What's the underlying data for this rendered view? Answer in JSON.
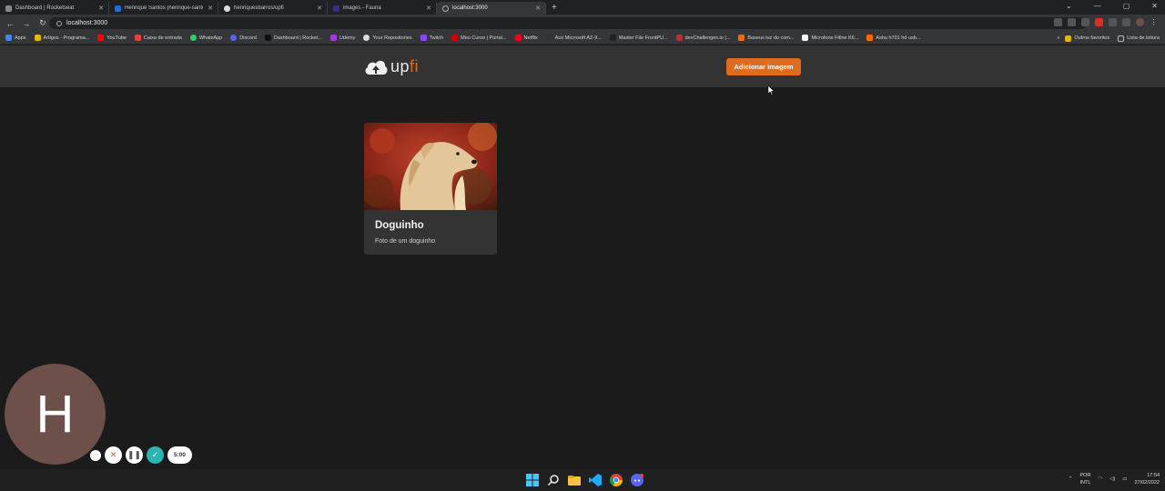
{
  "browser": {
    "tabs": [
      {
        "title": "Dashboard | Rocketseat"
      },
      {
        "title": "Henrique Santos (henrique-santos)"
      },
      {
        "title": "henriquesbarros/upfi"
      },
      {
        "title": "images - Fauna"
      },
      {
        "title": "localhost:3000"
      }
    ],
    "url": "localhost:3000",
    "bookmarks": [
      "Apps",
      "Artigos - Programa...",
      "YouTube",
      "Caixa de entrada",
      "WhatsApp",
      "Discord",
      "Dashboard | Rocket...",
      "Udemy",
      "Your Repositories",
      "Twitch",
      "Meu Curso | Portal...",
      "Netflix",
      "Ace Microsoft AZ-9...",
      "Master File FrontPU...",
      "devChallenges.io |...",
      "Baseus luz do com...",
      "Microfone Fifine K6...",
      "Ashu h701 hd usb..."
    ],
    "bookmarks_right": [
      "Outros favoritos",
      "Lista de leitura"
    ]
  },
  "app": {
    "logo_up": "up",
    "logo_fi": "fi",
    "add_button": "Adicionar imagem",
    "accent": "#dd6b20",
    "cards": [
      {
        "title": "Doguinho",
        "description": "Foto de um doguinho"
      }
    ]
  },
  "recorder": {
    "avatar_letter": "H",
    "timer": "5:00"
  },
  "taskbar": {
    "lang1": "POR",
    "lang2": "INTL",
    "time": "17:54",
    "date": "27/02/2022"
  }
}
